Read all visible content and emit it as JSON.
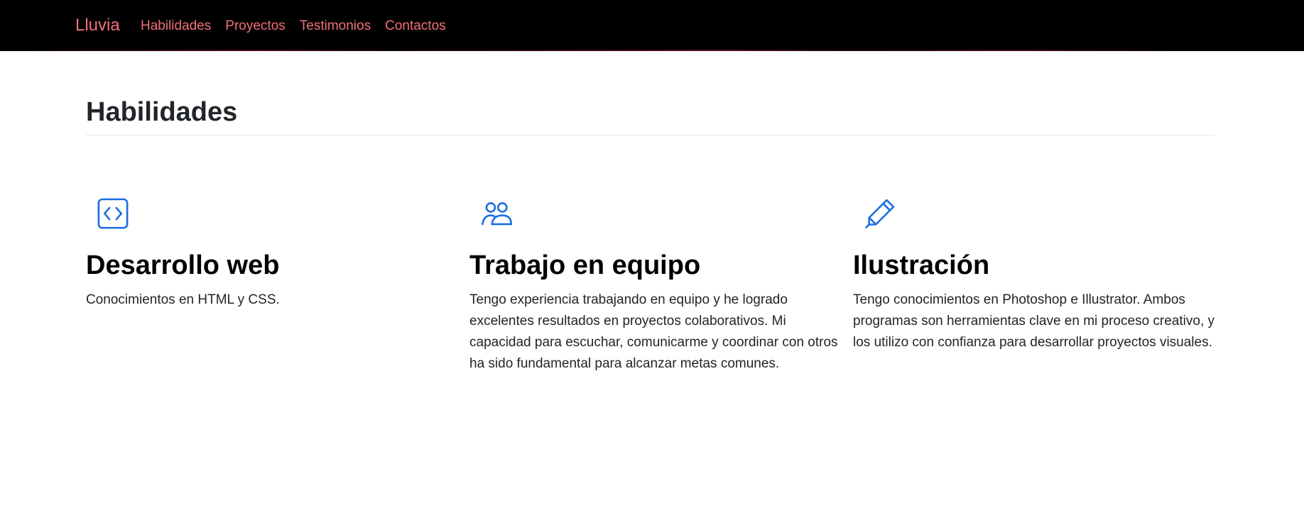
{
  "navbar": {
    "brand": "Lluvia",
    "links": [
      "Habilidades",
      "Proyectos",
      "Testimonios",
      "Contactos"
    ]
  },
  "section": {
    "title": "Habilidades"
  },
  "features": [
    {
      "icon": "code-square-icon",
      "title": "Desarrollo web",
      "text": "Conocimientos en HTML y CSS."
    },
    {
      "icon": "people-icon",
      "title": "Trabajo en equipo",
      "text": "Tengo experiencia trabajando en equipo y he logrado excelentes resultados en proyectos colaborativos. Mi capacidad para escuchar, comunicarme y coordinar con otros ha sido fundamental para alcanzar metas comunes."
    },
    {
      "icon": "pencil-icon",
      "title": "Ilustración",
      "text": "Tengo conocimientos en Photoshop e Illustrator. Ambos programas son herramientas clave en mi proceso creativo, y los utilizo con confianza para desarrollar proyectos visuales."
    }
  ],
  "colors": {
    "navbar_background": "#000000",
    "nav_link": "#f0707a",
    "icon_accent": "#1a6ee0",
    "heading": "#212529"
  }
}
